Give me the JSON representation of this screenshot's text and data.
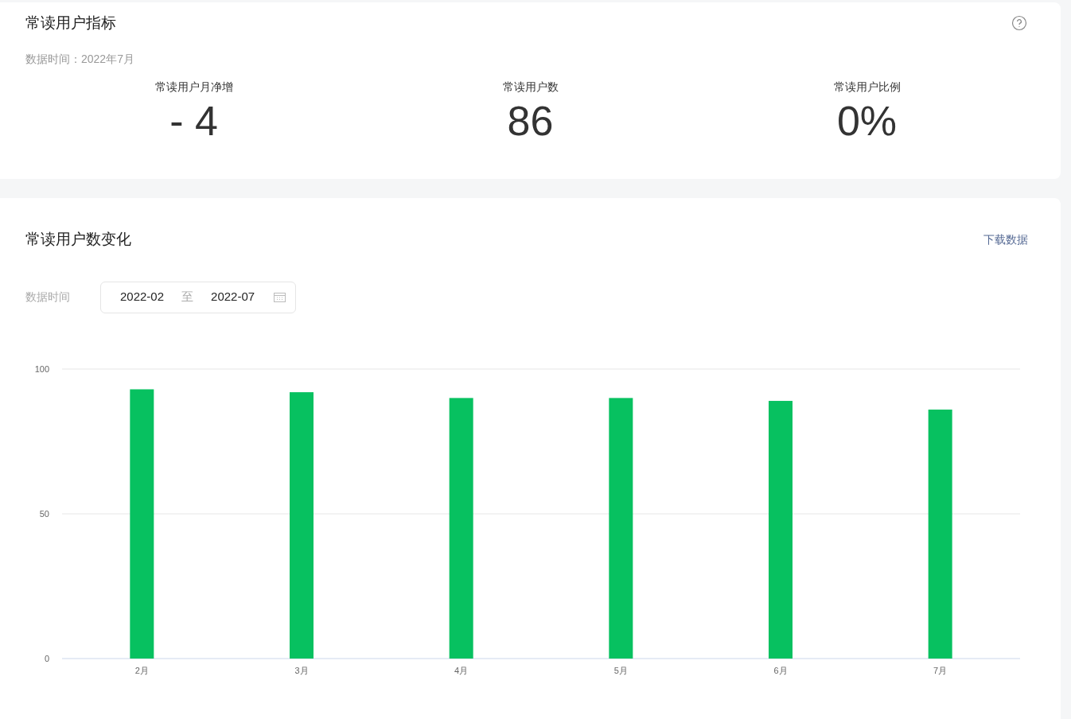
{
  "metrics_card": {
    "title": "常读用户指标",
    "data_time": "数据时间：2022年7月",
    "metrics": [
      {
        "label": "常读用户月净增",
        "value": "- 4"
      },
      {
        "label": "常读用户数",
        "value": "86"
      },
      {
        "label": "常读用户比例",
        "value": "0%"
      }
    ]
  },
  "trend_card": {
    "title": "常读用户数变化",
    "download_link": "下载数据",
    "date_label": "数据时间",
    "date_start": "2022-02",
    "date_separator": "至",
    "date_end": "2022-07",
    "chart_data": {
      "type": "bar",
      "categories": [
        "2月",
        "3月",
        "4月",
        "5月",
        "6月",
        "7月"
      ],
      "series": [
        {
          "color": "#07c160",
          "values": [
            93,
            92,
            90,
            90,
            89,
            86
          ]
        }
      ],
      "ylim": [
        0,
        100
      ],
      "yticks": [
        0,
        50,
        100
      ]
    }
  }
}
